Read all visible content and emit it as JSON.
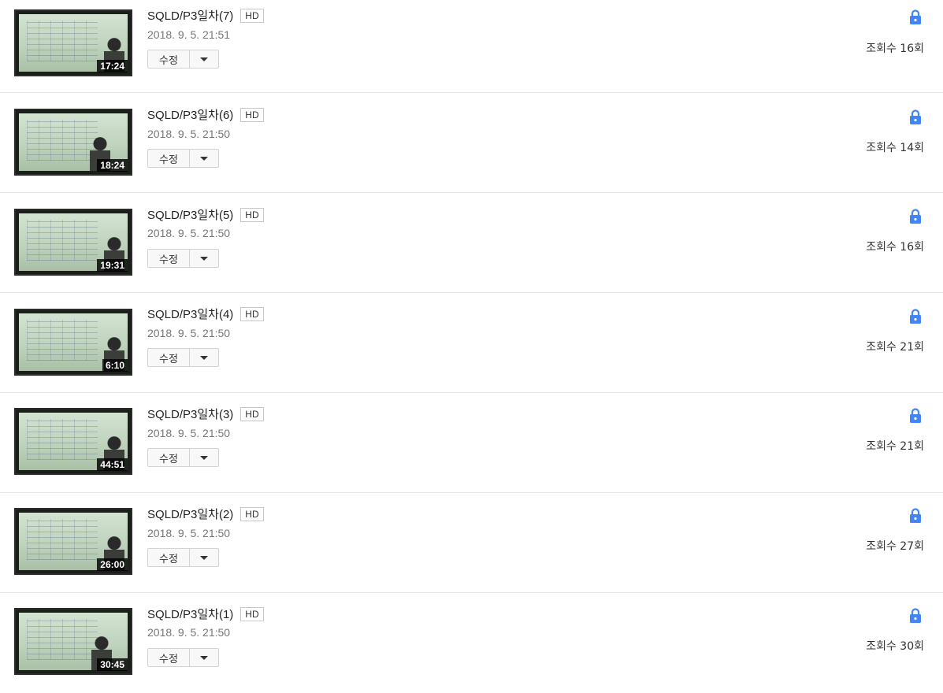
{
  "videos": [
    {
      "title": "SQLD/P3일차(7)",
      "quality": "HD",
      "date": "2018. 9. 5. 21:51",
      "duration": "17:24",
      "edit_label": "수정",
      "views": "조회수 16회"
    },
    {
      "title": "SQLD/P3일차(6)",
      "quality": "HD",
      "date": "2018. 9. 5. 21:50",
      "duration": "18:24",
      "edit_label": "수정",
      "views": "조회수 14회"
    },
    {
      "title": "SQLD/P3일차(5)",
      "quality": "HD",
      "date": "2018. 9. 5. 21:50",
      "duration": "19:31",
      "edit_label": "수정",
      "views": "조회수 16회"
    },
    {
      "title": "SQLD/P3일차(4)",
      "quality": "HD",
      "date": "2018. 9. 5. 21:50",
      "duration": "6:10",
      "edit_label": "수정",
      "views": "조회수 21회"
    },
    {
      "title": "SQLD/P3일차(3)",
      "quality": "HD",
      "date": "2018. 9. 5. 21:50",
      "duration": "44:51",
      "edit_label": "수정",
      "views": "조회수 21회"
    },
    {
      "title": "SQLD/P3일차(2)",
      "quality": "HD",
      "date": "2018. 9. 5. 21:50",
      "duration": "26:00",
      "edit_label": "수정",
      "views": "조회수 27회"
    },
    {
      "title": "SQLD/P3일차(1)",
      "quality": "HD",
      "date": "2018. 9. 5. 21:50",
      "duration": "30:45",
      "edit_label": "수정",
      "views": "조회수 30회"
    }
  ],
  "icons": {
    "privacy": "lock-icon",
    "more": "chevron-down-icon"
  },
  "colors": {
    "lock": "#4285f4",
    "duration_bg": "#000000"
  }
}
